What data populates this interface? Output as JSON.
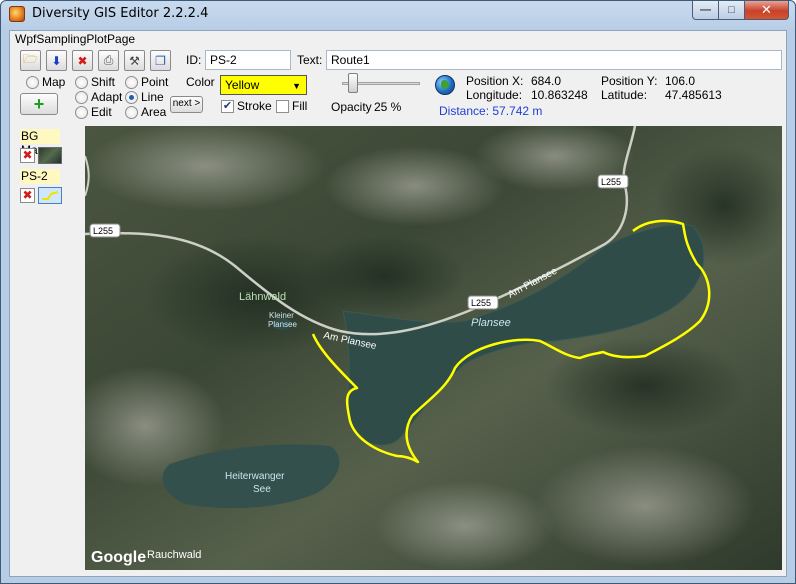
{
  "window": {
    "title": "Diversity GIS Editor 2.2.2.4",
    "minimize_label": "—",
    "maximize_label": "□",
    "close_label": "✕"
  },
  "tab": {
    "label": "WpfSamplingPlotPage"
  },
  "toolbar": {
    "icons": [
      "open-folder-icon",
      "download-icon",
      "delete-icon",
      "print-icon",
      "settings-icon",
      "copy-icon"
    ]
  },
  "form": {
    "id_label": "ID:",
    "id_value": "PS-2",
    "text_label": "Text:",
    "text_value": "Route1",
    "color_label": "Color",
    "color_value": "Yellow",
    "color_hex": "#ffff00",
    "stroke_label": "Stroke",
    "stroke_checked": true,
    "fill_label": "Fill",
    "fill_checked": false,
    "opacity_label": "Opacity",
    "opacity_value": "25 %",
    "next_label": "next >"
  },
  "modes": {
    "map_label": "Map",
    "shift_label": "Shift",
    "adapt_label": "Adapt",
    "edit_label": "Edit",
    "point_label": "Point",
    "line_label": "Line",
    "area_label": "Area",
    "selected": "Line"
  },
  "position": {
    "x_label": "Position X:",
    "x_value": "684.0",
    "y_label": "Position Y:",
    "y_value": "106.0",
    "lon_label": "Longitude:",
    "lon_value": "10.863248",
    "lat_label": "Latitude:",
    "lat_value": "47.485613",
    "distance": "Distance: 57.742  m"
  },
  "layers": [
    {
      "label": "BG Map"
    },
    {
      "label": "PS-2"
    }
  ],
  "map": {
    "labels": {
      "road1": "L255",
      "road2": "L255",
      "road3": "L255",
      "am_plansee_1": "Am Plansee",
      "am_plansee_2": "Am Plansee",
      "lahnwald": "Lähnwald",
      "kleiner": "Kleiner",
      "plansee_small": "Plansee",
      "plansee": "Plansee",
      "heiterwanger_1": "Heiterwanger",
      "heiterwanger_2": "See",
      "google": "Google",
      "rauchwald": "Rauchwald"
    },
    "route_color": "#ffff00",
    "lake_color": "#2f4c48"
  }
}
